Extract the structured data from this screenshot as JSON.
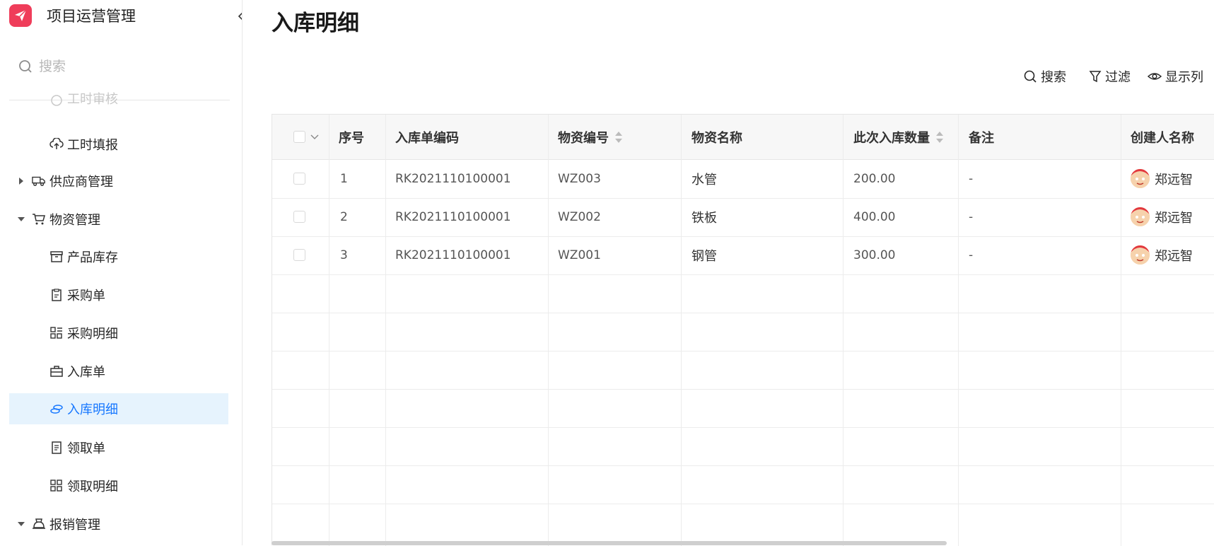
{
  "app": {
    "title": "项目运营管理"
  },
  "sidebar": {
    "search_placeholder": "搜索",
    "items": [
      {
        "label": "工时审核",
        "kind": "sub",
        "icon": "clock-icon"
      },
      {
        "label": "工时填报",
        "kind": "sub",
        "icon": "cloud-upload-icon"
      },
      {
        "label": "供应商管理",
        "kind": "group",
        "icon": "truck-icon",
        "expanded": false
      },
      {
        "label": "物资管理",
        "kind": "group",
        "icon": "cart-icon",
        "expanded": true
      },
      {
        "label": "产品库存",
        "kind": "sub",
        "icon": "archive-icon"
      },
      {
        "label": "采购单",
        "kind": "sub",
        "icon": "clipboard-icon"
      },
      {
        "label": "采购明细",
        "kind": "sub",
        "icon": "grid-list-icon"
      },
      {
        "label": "入库单",
        "kind": "sub",
        "icon": "toolbox-icon"
      },
      {
        "label": "入库明细",
        "kind": "sub",
        "icon": "coins-icon",
        "active": true
      },
      {
        "label": "领取单",
        "kind": "sub",
        "icon": "receipt-icon"
      },
      {
        "label": "领取明细",
        "kind": "sub",
        "icon": "grid-icon"
      },
      {
        "label": "报销管理",
        "kind": "group",
        "icon": "money-bag-icon",
        "expanded": true
      }
    ]
  },
  "page": {
    "title": "入库明细"
  },
  "toolbar": {
    "search": "搜索",
    "filter": "过滤",
    "columns": "显示列"
  },
  "table": {
    "columns": [
      "序号",
      "入库单编码",
      "物资编号",
      "物资名称",
      "此次入库数量",
      "备注",
      "创建人名称"
    ],
    "rows": [
      {
        "seq": "1",
        "code": "RK2021110100001",
        "material_no": "WZ003",
        "material_name": "水管",
        "qty": "200.00",
        "remark": "-",
        "creator": "郑远智"
      },
      {
        "seq": "2",
        "code": "RK2021110100001",
        "material_no": "WZ002",
        "material_name": "铁板",
        "qty": "400.00",
        "remark": "-",
        "creator": "郑远智"
      },
      {
        "seq": "3",
        "code": "RK2021110100001",
        "material_no": "WZ001",
        "material_name": "钢管",
        "qty": "300.00",
        "remark": "-",
        "creator": "郑远智"
      }
    ]
  },
  "colors": {
    "accent": "#1677ff",
    "active_bg": "#e6f3fd",
    "logo": "#ef3d5a"
  }
}
